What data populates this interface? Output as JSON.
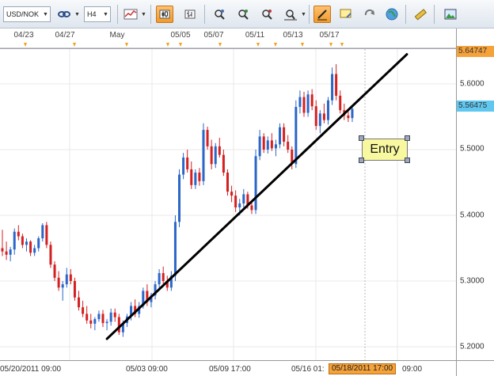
{
  "toolbar": {
    "symbol": "USD/NOK",
    "timeframe": "H4",
    "buttons": [
      "link-icon",
      "indicator-icon",
      "candle-icon",
      "bar-icon",
      "crosshair-icon",
      "zoom-in-icon",
      "zoom-out-icon",
      "zoom-fit-icon",
      "line-tool-icon",
      "note-icon",
      "refresh-icon",
      "globe-icon",
      "ruler-icon",
      "image-icon"
    ]
  },
  "top_dates": [
    "04/23",
    "04/27",
    "May",
    "05/05",
    "05/07",
    "05/11",
    "05/13",
    "05/17"
  ],
  "y_axis": {
    "ticks": [
      "5.6000",
      "5.5000",
      "5.4000",
      "5.3000",
      "5.2000"
    ],
    "high_flag": "5.64747",
    "current_flag": "5.56475",
    "high_flag_color": "#f6a23a",
    "current_flag_color": "#5fc7f0"
  },
  "x_axis": {
    "labels": [
      "05/20/2011 09:00",
      "05/03 09:00",
      "05/09 17:00",
      "05/16 01:",
      "09:00"
    ],
    "time_flag": "05/18/2011 17:00"
  },
  "annotation": {
    "label": "Entry"
  },
  "chart_data": {
    "type": "candlestick",
    "title": "",
    "ylim": [
      5.195,
      5.665
    ],
    "bull_color": "#2b66c8",
    "bear_color": "#d42020",
    "ohlc": [
      [
        5.35,
        5.378,
        5.338,
        5.345
      ],
      [
        5.345,
        5.36,
        5.332,
        5.34
      ],
      [
        5.34,
        5.352,
        5.33,
        5.348
      ],
      [
        5.348,
        5.38,
        5.34,
        5.375
      ],
      [
        5.375,
        5.385,
        5.362,
        5.368
      ],
      [
        5.368,
        5.372,
        5.35,
        5.355
      ],
      [
        5.355,
        5.365,
        5.345,
        5.36
      ],
      [
        5.36,
        5.362,
        5.338,
        5.343
      ],
      [
        5.343,
        5.355,
        5.338,
        5.35
      ],
      [
        5.35,
        5.368,
        5.345,
        5.365
      ],
      [
        5.365,
        5.388,
        5.36,
        5.385
      ],
      [
        5.385,
        5.39,
        5.35,
        5.355
      ],
      [
        5.355,
        5.36,
        5.32,
        5.325
      ],
      [
        5.325,
        5.33,
        5.3,
        5.305
      ],
      [
        5.305,
        5.315,
        5.285,
        5.29
      ],
      [
        5.29,
        5.3,
        5.27,
        5.295
      ],
      [
        5.295,
        5.32,
        5.29,
        5.31
      ],
      [
        5.31,
        5.318,
        5.295,
        5.3
      ],
      [
        5.3,
        5.305,
        5.27,
        5.275
      ],
      [
        5.275,
        5.285,
        5.255,
        5.26
      ],
      [
        5.26,
        5.27,
        5.245,
        5.25
      ],
      [
        5.25,
        5.262,
        5.235,
        5.24
      ],
      [
        5.24,
        5.25,
        5.228,
        5.235
      ],
      [
        5.235,
        5.245,
        5.225,
        5.242
      ],
      [
        5.242,
        5.255,
        5.238,
        5.25
      ],
      [
        5.25,
        5.256,
        5.23,
        5.236
      ],
      [
        5.236,
        5.242,
        5.225,
        5.238
      ],
      [
        5.238,
        5.258,
        5.232,
        5.252
      ],
      [
        5.252,
        5.258,
        5.238,
        5.245
      ],
      [
        5.245,
        5.25,
        5.218,
        5.222
      ],
      [
        5.222,
        5.24,
        5.215,
        5.236
      ],
      [
        5.236,
        5.25,
        5.23,
        5.246
      ],
      [
        5.246,
        5.268,
        5.24,
        5.262
      ],
      [
        5.262,
        5.272,
        5.245,
        5.25
      ],
      [
        5.25,
        5.268,
        5.244,
        5.262
      ],
      [
        5.262,
        5.29,
        5.258,
        5.285
      ],
      [
        5.285,
        5.295,
        5.262,
        5.268
      ],
      [
        5.268,
        5.282,
        5.26,
        5.278
      ],
      [
        5.278,
        5.3,
        5.272,
        5.295
      ],
      [
        5.295,
        5.318,
        5.288,
        5.312
      ],
      [
        5.312,
        5.322,
        5.295,
        5.3
      ],
      [
        5.3,
        5.308,
        5.285,
        5.29
      ],
      [
        5.29,
        5.315,
        5.285,
        5.308
      ],
      [
        5.308,
        5.4,
        5.3,
        5.39
      ],
      [
        5.39,
        5.47,
        5.382,
        5.462
      ],
      [
        5.462,
        5.495,
        5.455,
        5.488
      ],
      [
        5.488,
        5.5,
        5.465,
        5.47
      ],
      [
        5.47,
        5.482,
        5.44,
        5.446
      ],
      [
        5.446,
        5.47,
        5.44,
        5.465
      ],
      [
        5.465,
        5.472,
        5.445,
        5.452
      ],
      [
        5.452,
        5.54,
        5.446,
        5.53
      ],
      [
        5.53,
        5.535,
        5.5,
        5.505
      ],
      [
        5.505,
        5.515,
        5.47,
        5.478
      ],
      [
        5.478,
        5.51,
        5.472,
        5.505
      ],
      [
        5.505,
        5.518,
        5.488,
        5.492
      ],
      [
        5.492,
        5.5,
        5.46,
        5.465
      ],
      [
        5.465,
        5.47,
        5.43,
        5.436
      ],
      [
        5.436,
        5.445,
        5.42,
        5.43
      ],
      [
        5.43,
        5.438,
        5.405,
        5.412
      ],
      [
        5.412,
        5.425,
        5.4,
        5.418
      ],
      [
        5.418,
        5.44,
        5.412,
        5.432
      ],
      [
        5.432,
        5.436,
        5.41,
        5.415
      ],
      [
        5.415,
        5.42,
        5.402,
        5.408
      ],
      [
        5.408,
        5.5,
        5.402,
        5.49
      ],
      [
        5.49,
        5.53,
        5.484,
        5.52
      ],
      [
        5.52,
        5.525,
        5.495,
        5.5
      ],
      [
        5.5,
        5.52,
        5.494,
        5.514
      ],
      [
        5.514,
        5.525,
        5.498,
        5.502
      ],
      [
        5.502,
        5.515,
        5.49,
        5.508
      ],
      [
        5.508,
        5.54,
        5.502,
        5.534
      ],
      [
        5.534,
        5.54,
        5.505,
        5.512
      ],
      [
        5.512,
        5.522,
        5.495,
        5.5
      ],
      [
        5.5,
        5.505,
        5.47,
        5.478
      ],
      [
        5.478,
        5.575,
        5.472,
        5.565
      ],
      [
        5.565,
        5.59,
        5.555,
        5.58
      ],
      [
        5.58,
        5.588,
        5.55,
        5.556
      ],
      [
        5.556,
        5.59,
        5.55,
        5.584
      ],
      [
        5.584,
        5.592,
        5.56,
        5.566
      ],
      [
        5.566,
        5.575,
        5.53,
        5.536
      ],
      [
        5.536,
        5.56,
        5.525,
        5.555
      ],
      [
        5.555,
        5.57,
        5.54,
        5.545
      ],
      [
        5.545,
        5.58,
        5.538,
        5.575
      ],
      [
        5.575,
        5.625,
        5.568,
        5.615
      ],
      [
        5.615,
        5.63,
        5.575,
        5.582
      ],
      [
        5.582,
        5.59,
        5.555,
        5.56
      ],
      [
        5.56,
        5.57,
        5.545,
        5.552
      ],
      [
        5.552,
        5.562,
        5.542,
        5.548
      ],
      [
        5.548,
        5.566,
        5.542,
        5.562
      ]
    ],
    "trendline": {
      "start": [
        26,
        5.212
      ],
      "end": [
        99,
        5.645
      ]
    }
  }
}
